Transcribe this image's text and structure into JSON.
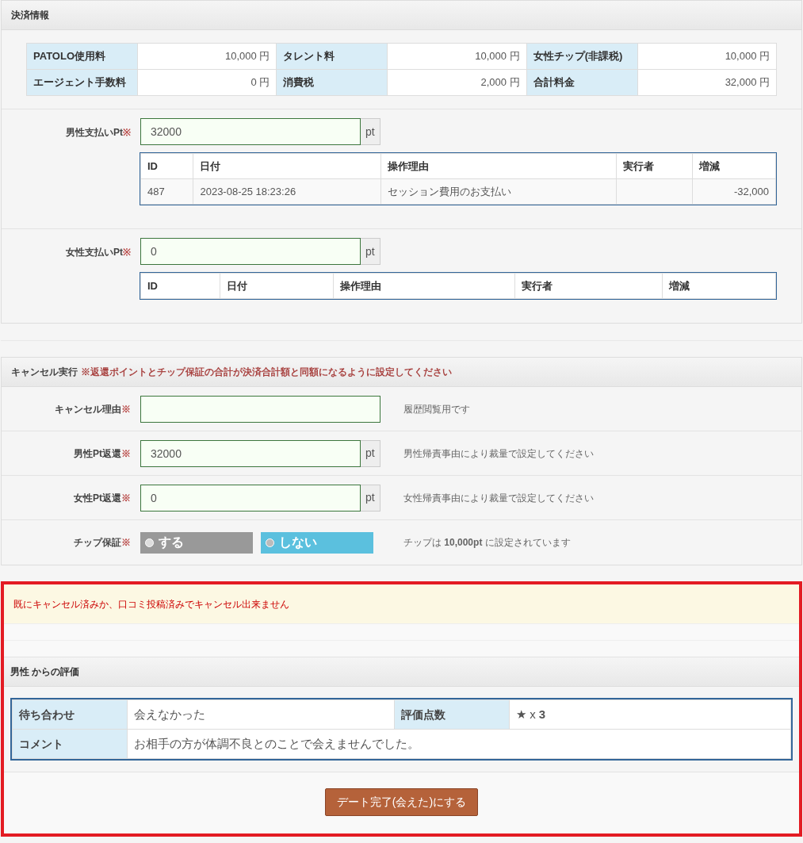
{
  "payment": {
    "title": "決済情報",
    "fees": [
      {
        "label": "PATOLO使用料",
        "value": "10,000 円"
      },
      {
        "label": "タレント料",
        "value": "10,000 円"
      },
      {
        "label": "女性チップ(非課税)",
        "value": "10,000 円"
      },
      {
        "label": "エージェント手数料",
        "value": "0 円"
      },
      {
        "label": "消費税",
        "value": "2,000 円"
      },
      {
        "label": "合計料金",
        "value": "32,000 円"
      }
    ],
    "points": [
      {
        "label": "男性支払いPt",
        "required": "※",
        "value": "32000",
        "unit": "pt",
        "columns": [
          "ID",
          "日付",
          "操作理由",
          "実行者",
          "増減"
        ],
        "rows": [
          [
            "487",
            "2023-08-25 18:23:26",
            "セッション費用のお支払い",
            "",
            "-32,000"
          ]
        ]
      },
      {
        "label": "女性支払いPt",
        "required": "※",
        "value": "0",
        "unit": "pt",
        "columns": [
          "ID",
          "日付",
          "操作理由",
          "実行者",
          "増減"
        ]
      }
    ]
  },
  "cancel": {
    "title": "キャンセル実行",
    "note": "※返還ポイントとチップ保証の合計が決済合計額と同額になるように設定してください",
    "fields": [
      {
        "kind": "text",
        "label": "キャンセル理由",
        "required": "※",
        "hint": "履歴閲覧用です"
      },
      {
        "kind": "points",
        "label": "男性Pt返還",
        "required": "※",
        "value": "32000",
        "unit": "pt",
        "hint": "男性帰責事由により裁量で設定してください"
      },
      {
        "kind": "points",
        "label": "女性Pt返還",
        "required": "※",
        "value": "0",
        "unit": "pt",
        "hint": "女性帰責事由により裁量で設定してください"
      },
      {
        "kind": "radio",
        "label": "チップ保証",
        "required": "※",
        "options": [
          {
            "label": "する",
            "selected": false
          },
          {
            "label": "しない",
            "selected": true
          }
        ],
        "hint": "チップは **10,000pt** に設定されています"
      }
    ]
  },
  "review": {
    "alert": "既にキャンセル済みか、口コミ投稿済みでキャンセル出来ません",
    "title": "男性 からの評価",
    "rows": [
      [
        {
          "label": "待ち合わせ",
          "value": "会えなかった"
        },
        {
          "label": "評価点数",
          "value": "★ x **3**"
        }
      ],
      [
        {
          "label": "コメント",
          "value": "お相手の方が体調不良とのことで会えませんでした。"
        }
      ]
    ],
    "button": "デート完了(会えた)にする"
  }
}
